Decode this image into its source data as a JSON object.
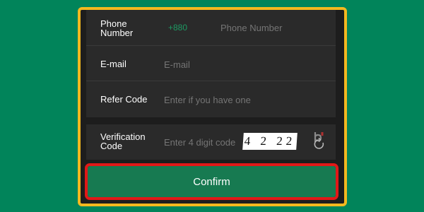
{
  "form": {
    "phone": {
      "label": "Phone Number",
      "prefix": "+880",
      "placeholder": "Phone Number"
    },
    "email": {
      "label": "E-mail",
      "placeholder": "E-mail"
    },
    "refer": {
      "label": "Refer Code",
      "placeholder": "Enter if you have one"
    },
    "verification": {
      "label": "Verification Code",
      "placeholder": "Enter 4 digit code",
      "captcha": "4 2 22"
    }
  },
  "confirm_label": "Confirm",
  "colors": {
    "background": "#01845a",
    "frame": "#f3b81f",
    "highlight": "#e11818",
    "button": "#177a51",
    "prefix": "#1d9a63"
  },
  "icons": {
    "refresh": "refresh-icon"
  }
}
